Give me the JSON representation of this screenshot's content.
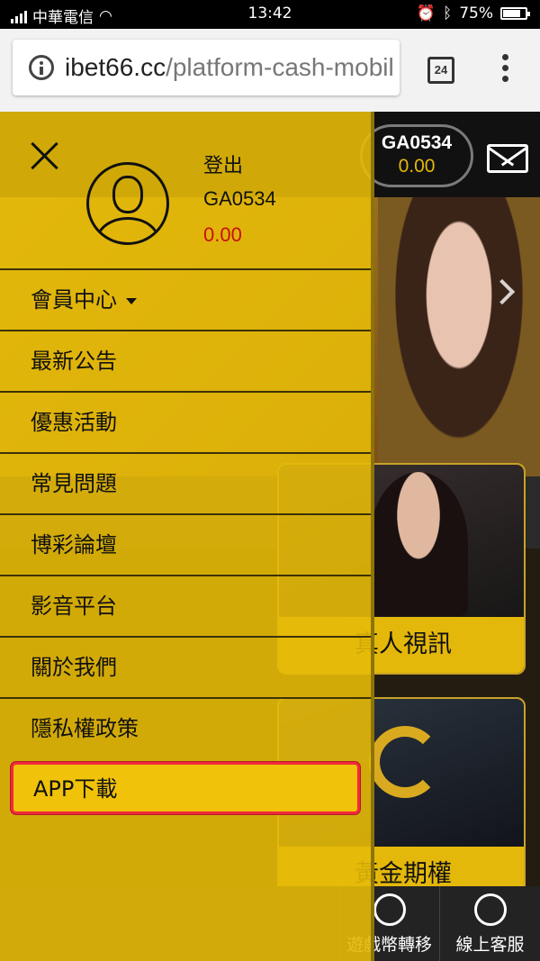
{
  "status_bar": {
    "carrier": "中華電信",
    "time": "13:42",
    "battery": "75%"
  },
  "browser": {
    "url_domain": "ibet66.cc",
    "url_path": "/platform-cash-mobil",
    "tab_count": "24"
  },
  "page": {
    "account_id": "GA0534",
    "account_balance": "0.00",
    "card1_label": "真人視訊",
    "card2_label": "黃金期權",
    "bottom_nav": [
      "遊戲幣轉移",
      "線上客服"
    ]
  },
  "drawer": {
    "logout": "登出",
    "username": "GA0534",
    "balance": "0.00",
    "menu": [
      {
        "label": "會員中心",
        "has_caret": true
      },
      {
        "label": "最新公告"
      },
      {
        "label": "優惠活動"
      },
      {
        "label": "常見問題"
      },
      {
        "label": "博彩論壇"
      },
      {
        "label": "影音平台"
      },
      {
        "label": "關於我們"
      },
      {
        "label": "隱私權政策"
      },
      {
        "label": "APP下載",
        "highlighted": true
      }
    ]
  },
  "colors": {
    "drawer_bg": "#e6ba08",
    "highlight_border": "#f0293a",
    "balance_text": "#c81010"
  }
}
